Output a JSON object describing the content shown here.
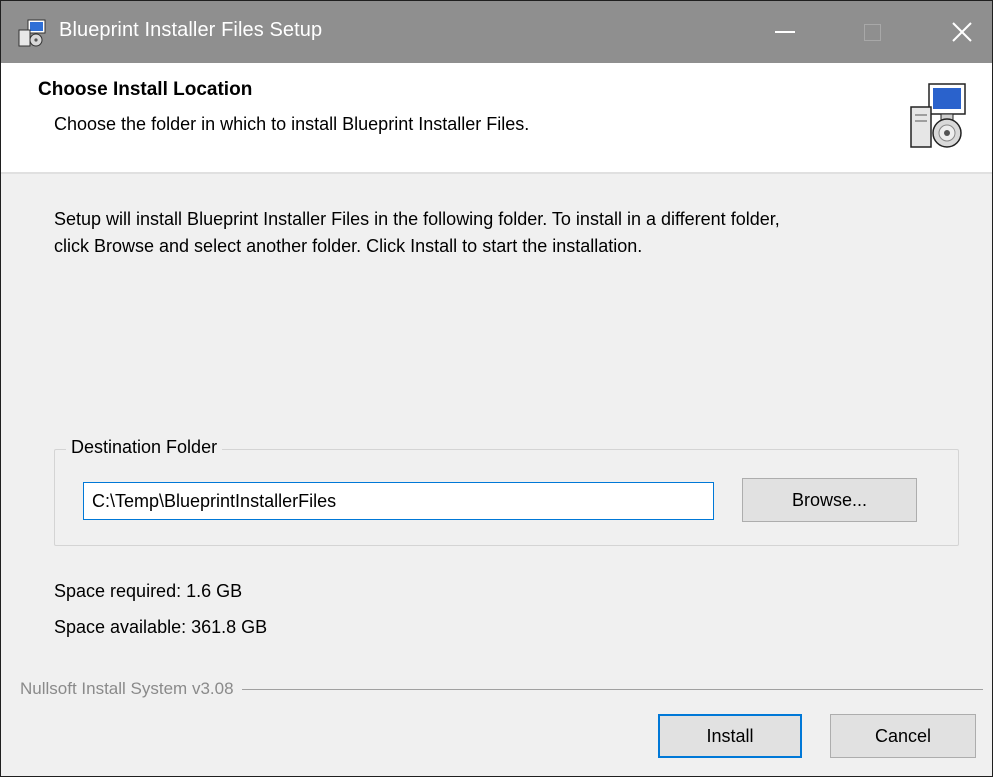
{
  "window": {
    "title": "Blueprint Installer Files Setup",
    "titlebar_color": "#8f8f8f",
    "icons": {
      "app": "installer-app-icon",
      "minimize": "minimize-icon",
      "maximize": "maximize-icon",
      "close": "close-icon"
    }
  },
  "header": {
    "title": "Choose Install Location",
    "subtitle": "Choose the folder in which to install Blueprint Installer Files.",
    "icon": "setup-computer-cd-icon"
  },
  "body": {
    "intro_line1": "Setup will install Blueprint Installer Files in the following folder. To install in a different folder,",
    "intro_line2": "click Browse and select another folder. Click Install to start the installation."
  },
  "destination": {
    "group_label": "Destination Folder",
    "path": "C:\\Temp\\BlueprintInstallerFiles",
    "browse_label": "Browse..."
  },
  "space": {
    "required": "Space required: 1.6 GB",
    "available": "Space available: 361.8 GB"
  },
  "footer": {
    "brand": "Nullsoft Install System v3.08",
    "install_label": "Install",
    "cancel_label": "Cancel",
    "accent": "#0078d7"
  }
}
